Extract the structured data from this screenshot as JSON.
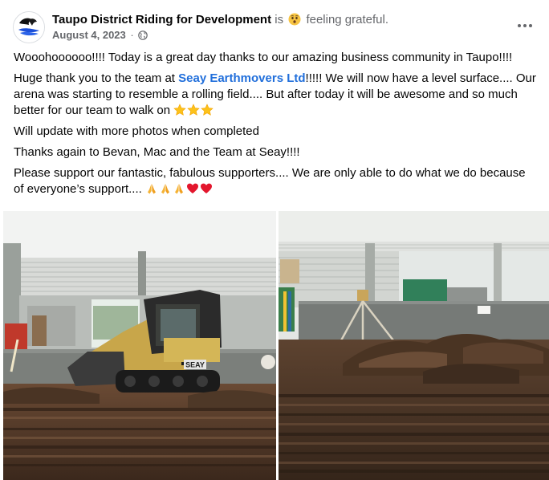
{
  "post": {
    "page_name": "Taupo District Riding for Development",
    "is_text": "is",
    "feeling_text": "feeling grateful.",
    "feeling_icon": "grateful-face-emoji",
    "date": "August 4, 2023",
    "separator": "·",
    "audience_icon": "globe-icon",
    "more_icon": "more-options-icon"
  },
  "body": {
    "p1": "Wooohoooooo!!!! Today is a great day thanks to our amazing business community in Taupo!!!!",
    "p2_before": "Huge thank you to the team at ",
    "p2_mention": "Seay Earthmovers Ltd",
    "p2_after": "!!!!!  We will now have a level surface....  Our arena was starting to resemble a rolling field.... But after today it will be awesome and so much better for our team to walk on ",
    "p2_emojis": [
      "star",
      "star",
      "star"
    ],
    "p3": "Will update with more photos when completed",
    "p4": "Thanks again to Bevan, Mac and the Team at Seay!!!!",
    "p5": "Please support our fantastic, fabulous supporters....  We are only able to do what we do because of everyone’s support.... ",
    "p5_emojis": [
      "folded-hands",
      "folded-hands",
      "folded-hands",
      "red-heart",
      "red-heart"
    ]
  },
  "photos": {
    "left_badge": "SEAY",
    "colors": {
      "link": "#216fdb",
      "meta": "#65676b",
      "text": "#050505"
    }
  }
}
